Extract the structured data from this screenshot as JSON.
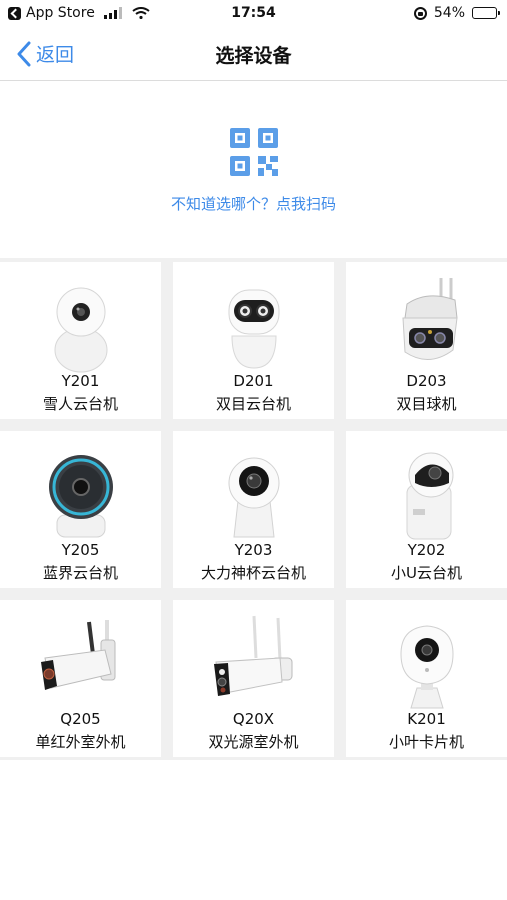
{
  "status_bar": {
    "back_app": "App Store",
    "time": "17:54",
    "battery": "54%",
    "battery_level": 0.54
  },
  "nav": {
    "back_label": "返回",
    "title": "选择设备"
  },
  "scan": {
    "icon": "qr-code-icon",
    "link_text": "不知道选哪个？点我扫码"
  },
  "devices": [
    {
      "model": "Y201",
      "name": "雪人云台机",
      "icon": "snowman-ptz-camera"
    },
    {
      "model": "D201",
      "name": "双目云台机",
      "icon": "dual-lens-ptz-camera"
    },
    {
      "model": "D203",
      "name": "双目球机",
      "icon": "dual-lens-dome-camera"
    },
    {
      "model": "Y205",
      "name": "蓝界云台机",
      "icon": "blue-ring-ptz-camera"
    },
    {
      "model": "Y203",
      "name": "大力神杯云台机",
      "icon": "cup-ptz-camera"
    },
    {
      "model": "Y202",
      "name": "小U云台机",
      "icon": "small-u-ptz-camera"
    },
    {
      "model": "Q205",
      "name": "单红外室外机",
      "icon": "outdoor-bullet-camera"
    },
    {
      "model": "Q20X",
      "name": "双光源室外机",
      "icon": "dual-light-bullet-camera"
    },
    {
      "model": "K201",
      "name": "小叶卡片机",
      "icon": "card-camera"
    }
  ]
}
